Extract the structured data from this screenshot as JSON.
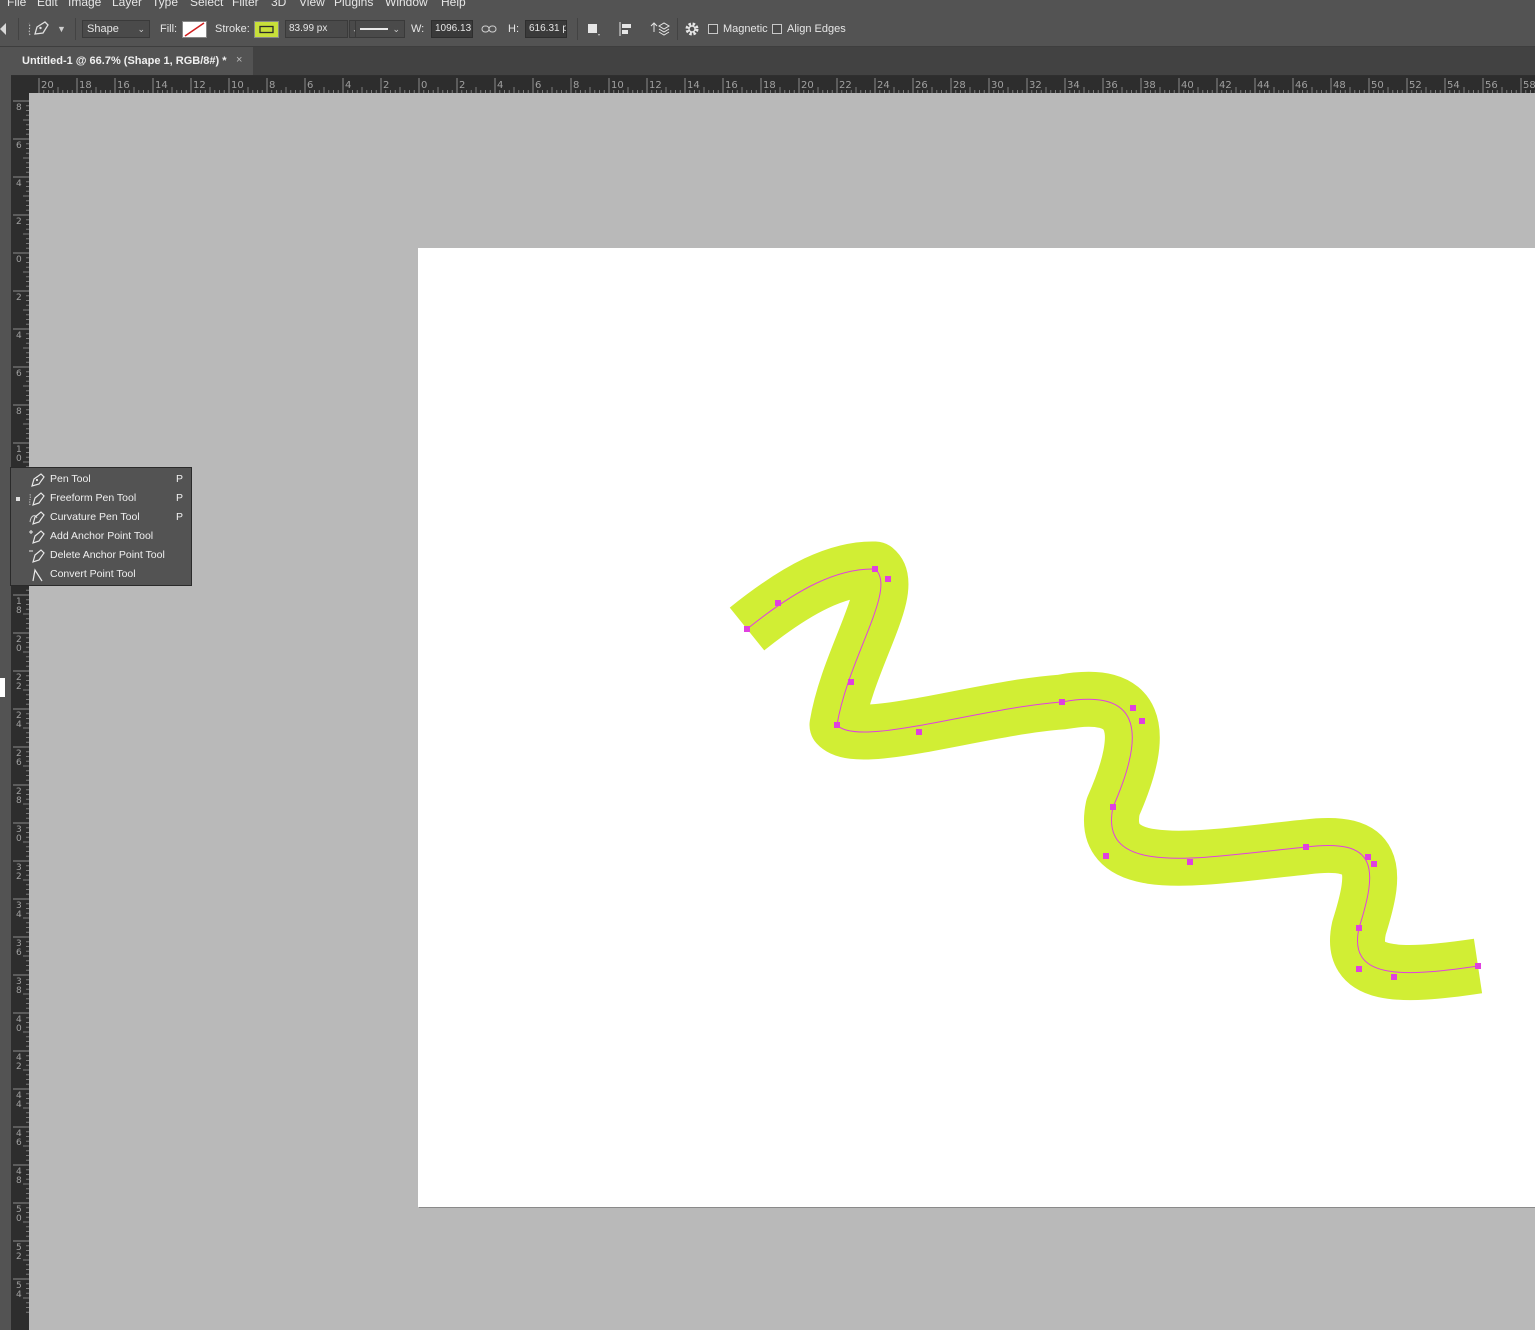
{
  "menubar": {
    "items": [
      "File",
      "Edit",
      "Image",
      "Layer",
      "Type",
      "Select",
      "Filter",
      "3D",
      "View",
      "Plugins",
      "Window",
      "Help"
    ]
  },
  "options": {
    "mode": "Shape",
    "fill_label": "Fill:",
    "stroke_label": "Stroke:",
    "stroke_color": "#c8e03a",
    "stroke_width": "83.99 px",
    "w_label": "W:",
    "w_value": "1096.13",
    "h_label": "H:",
    "h_value": "616.31 p",
    "magnetic_label": "Magnetic",
    "align_edges_label": "Align Edges"
  },
  "document": {
    "tab_title": "Untitled-1 @ 66.7% (Shape 1, RGB/8#) *",
    "close_glyph": "×"
  },
  "rulers": {
    "top": [
      "20",
      "18",
      "16",
      "14",
      "12",
      "10",
      "8",
      "6",
      "4",
      "2",
      "0",
      "2",
      "4",
      "6",
      "8",
      "10",
      "12",
      "14",
      "16",
      "18",
      "20",
      "22",
      "24",
      "26",
      "28",
      "30",
      "32",
      "34",
      "36",
      "38",
      "40",
      "42",
      "44",
      "46",
      "48",
      "50",
      "52",
      "54",
      "56",
      "58"
    ],
    "left": [
      "8",
      "6",
      "4",
      "2",
      "0",
      "2",
      "4",
      "6",
      "8",
      "10",
      "12",
      "14",
      "16",
      "18",
      "20",
      "22",
      "24",
      "26",
      "28",
      "30",
      "32",
      "34",
      "36",
      "38",
      "40",
      "42",
      "44",
      "46",
      "48",
      "50",
      "52",
      "54"
    ]
  },
  "flyout": {
    "items": [
      {
        "label": "Pen Tool",
        "key": "P"
      },
      {
        "label": "Freeform Pen Tool",
        "key": "P"
      },
      {
        "label": "Curvature Pen Tool",
        "key": "P"
      },
      {
        "label": "Add Anchor Point Tool",
        "key": ""
      },
      {
        "label": "Delete Anchor Point Tool",
        "key": ""
      },
      {
        "label": "Convert Point Tool",
        "key": ""
      }
    ]
  },
  "shape": {
    "stroke_color": "#d1ee34",
    "path_color": "#e040e0"
  }
}
